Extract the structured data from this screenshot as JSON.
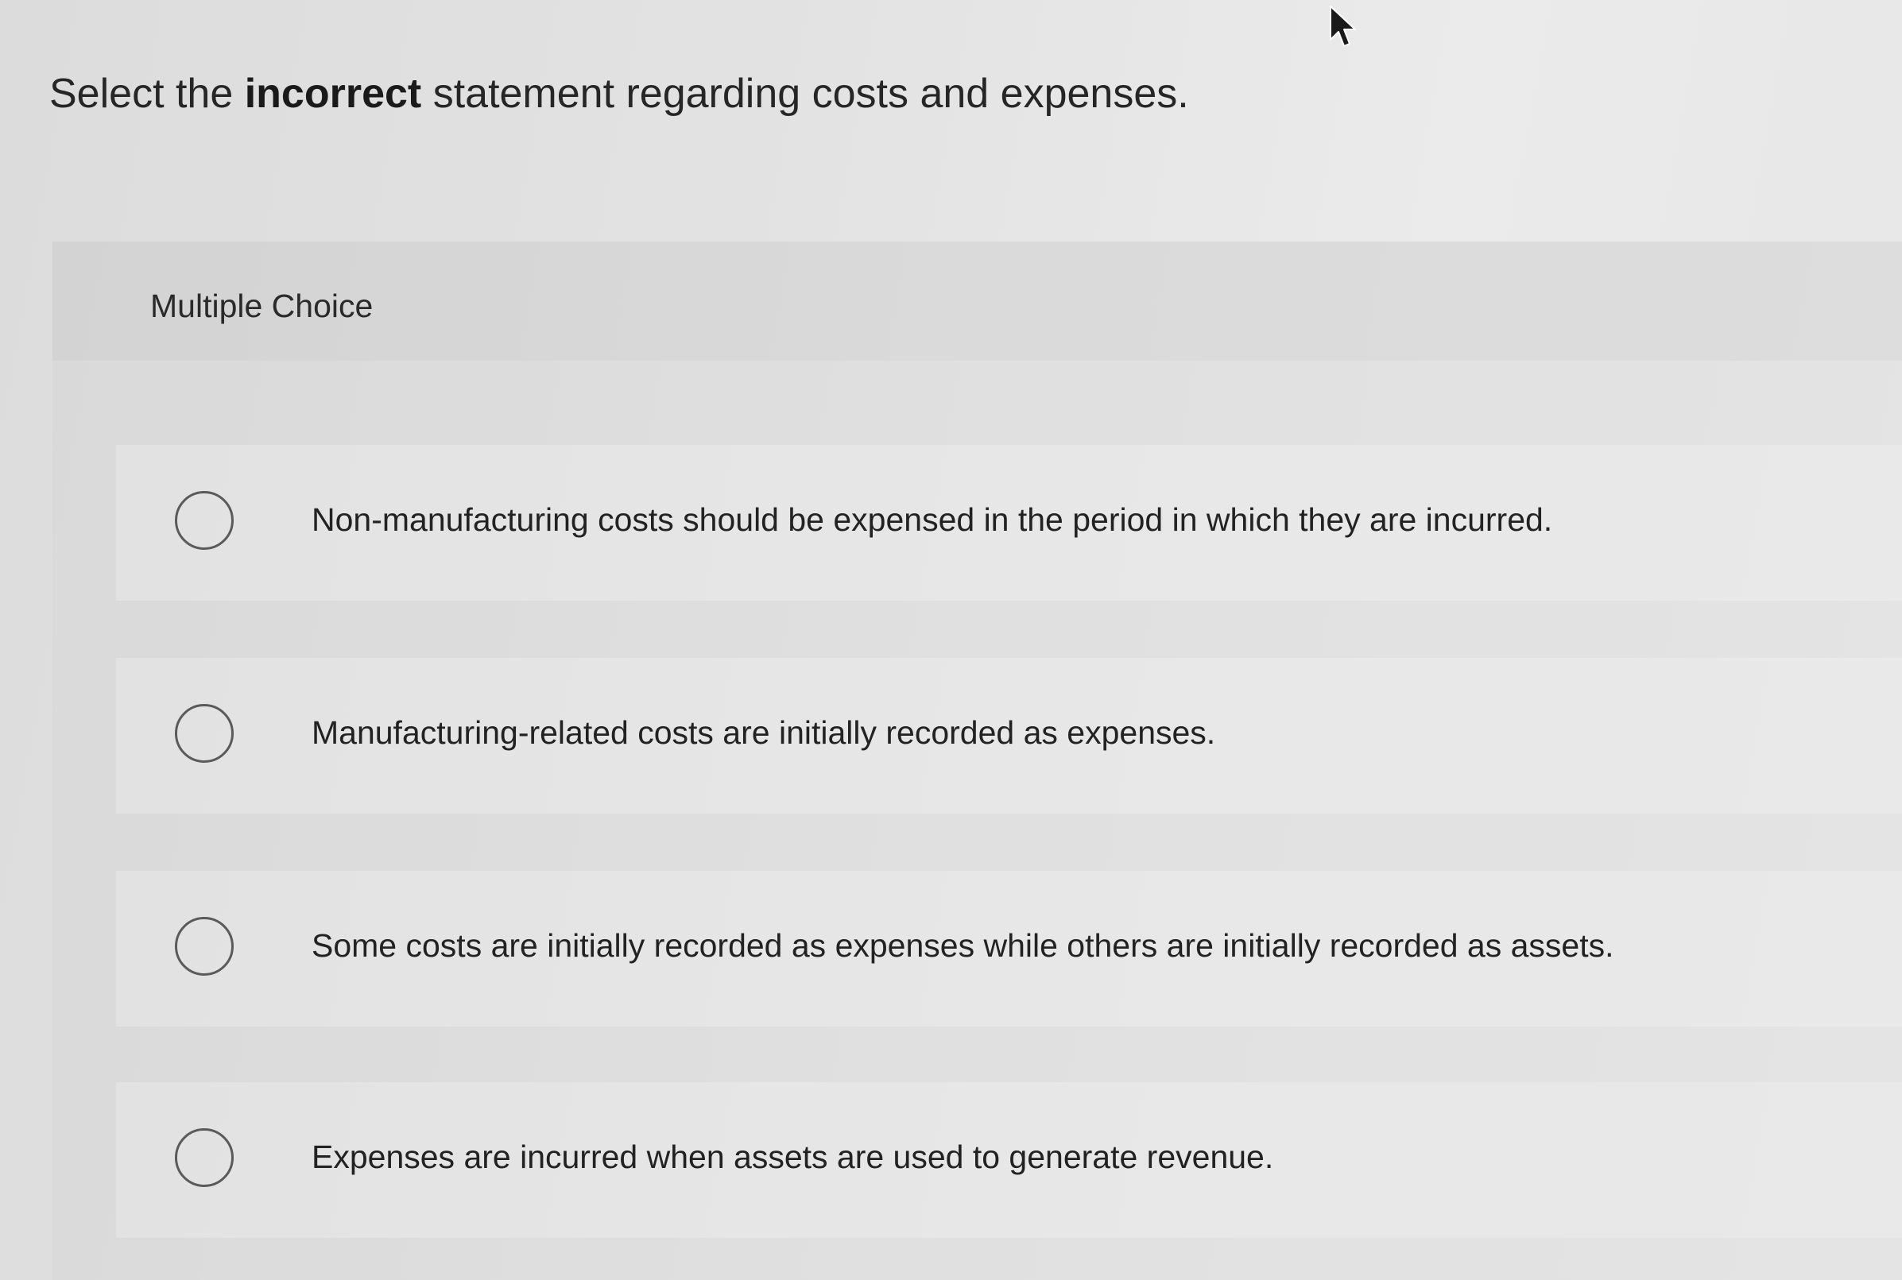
{
  "question": {
    "prefix": "Select the ",
    "emphasis": "incorrect",
    "suffix": " statement regarding costs and expenses."
  },
  "multiple_choice": {
    "label": "Multiple Choice",
    "options": [
      {
        "text": "Non-manufacturing costs should be expensed in the period in which they are incurred.",
        "selected": false
      },
      {
        "text": "Manufacturing-related costs are initially recorded as expenses.",
        "selected": false
      },
      {
        "text": "Some costs are initially recorded as expenses while others are initially recorded as assets.",
        "selected": false
      },
      {
        "text": "Expenses are incurred when assets are used to generate revenue.",
        "selected": false
      }
    ]
  },
  "colors": {
    "background": "#e3e3e3",
    "panel": "#dddddd",
    "radio_border": "#5a5a5a",
    "text": "#222222"
  }
}
